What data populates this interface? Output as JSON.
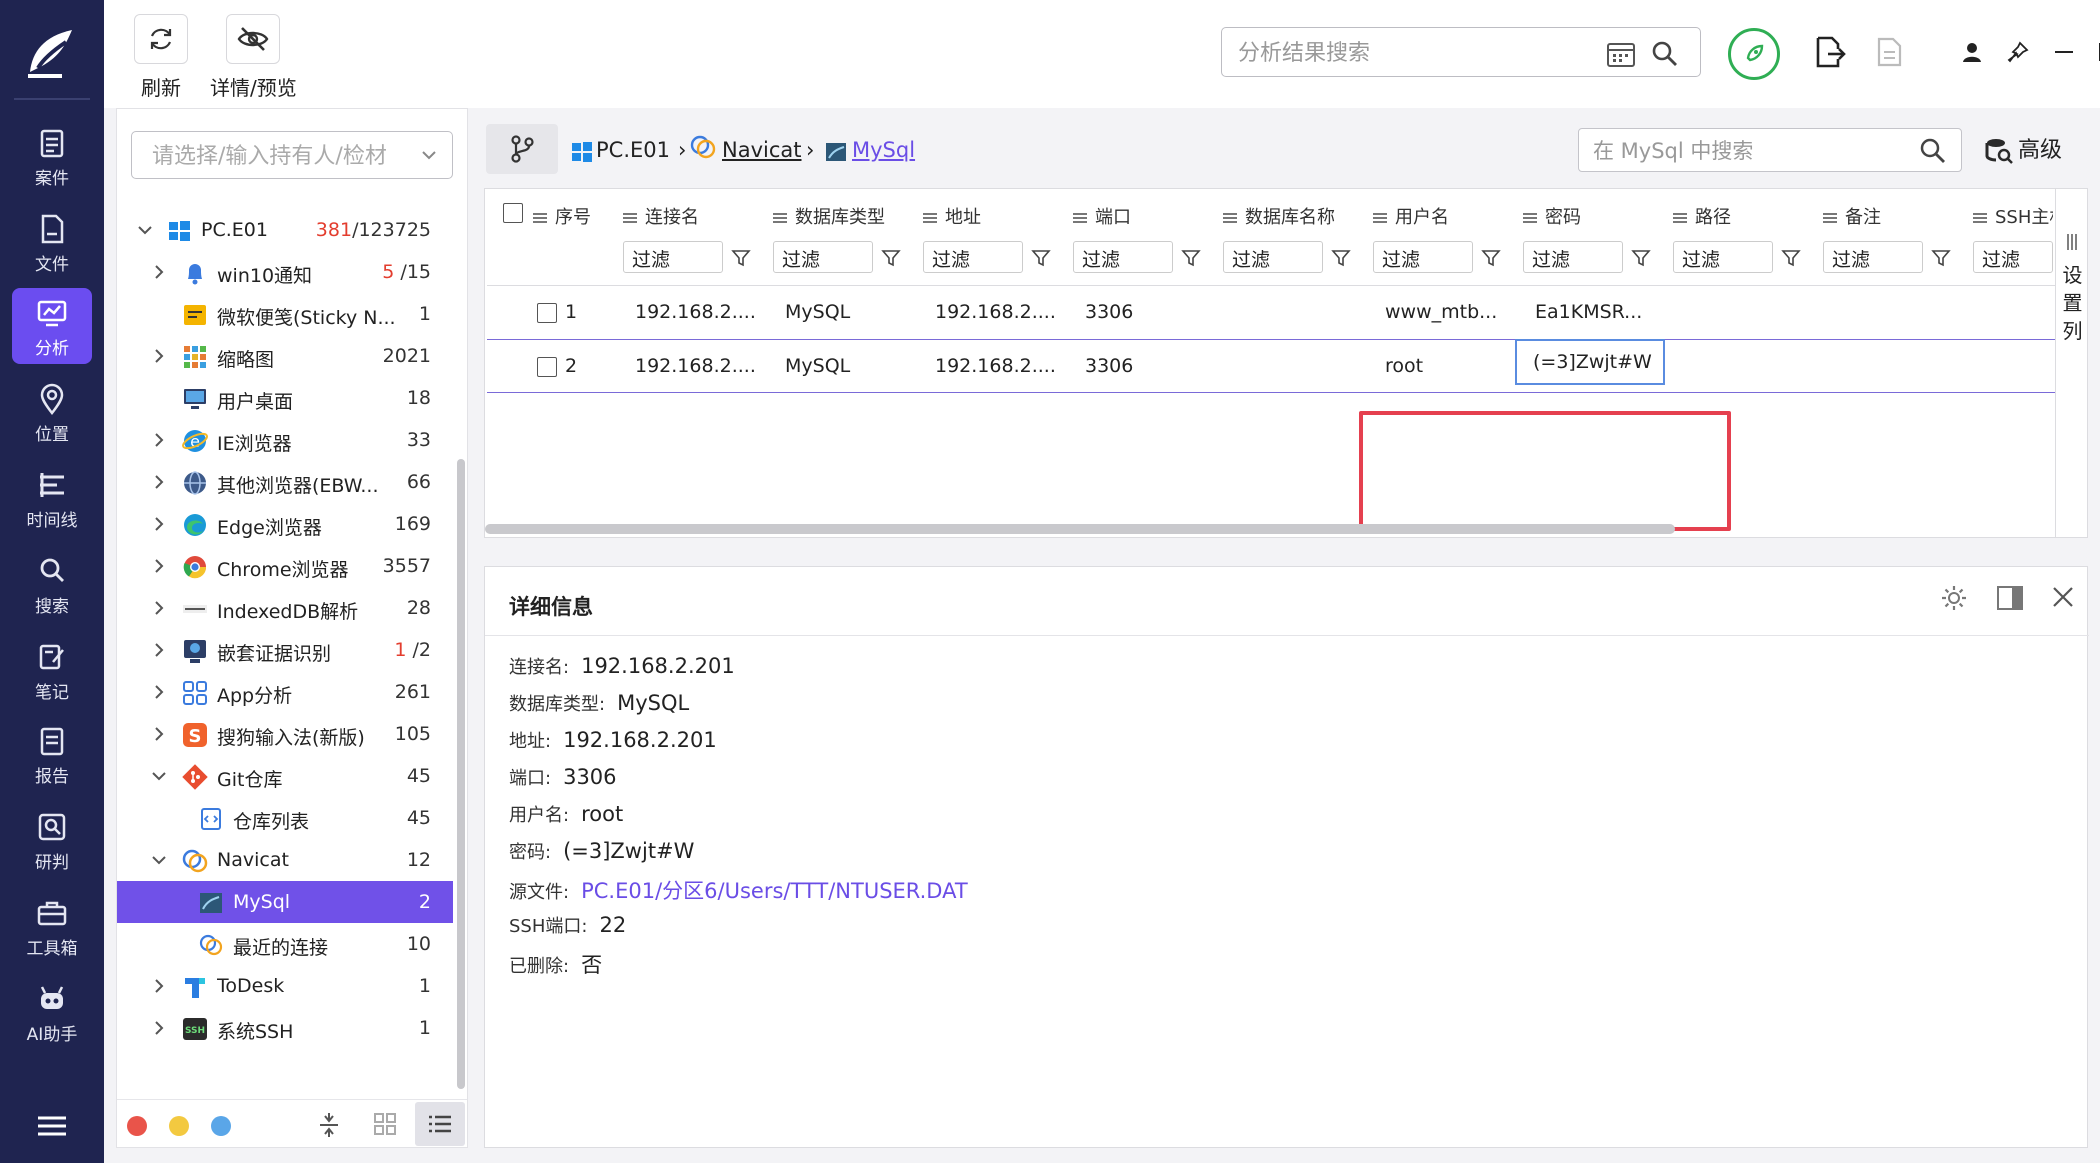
{
  "left_nav": {
    "items": [
      {
        "label": "案件",
        "icon": "clipboard-icon"
      },
      {
        "label": "文件",
        "icon": "file-icon"
      },
      {
        "label": "分析",
        "icon": "analysis-icon"
      },
      {
        "label": "位置",
        "icon": "location-pin-icon"
      },
      {
        "label": "时间线",
        "icon": "timeline-icon"
      },
      {
        "label": "搜索",
        "icon": "search-icon"
      },
      {
        "label": "笔记",
        "icon": "note-icon"
      },
      {
        "label": "报告",
        "icon": "report-icon"
      },
      {
        "label": "研判",
        "icon": "judgement-icon"
      },
      {
        "label": "工具箱",
        "icon": "toolbox-icon"
      },
      {
        "label": "AI助手",
        "icon": "robot-icon"
      }
    ],
    "active": "分析"
  },
  "toolbar": {
    "refresh_label": "刷新",
    "details_label": "详情/预览",
    "search_placeholder": "分析结果搜索"
  },
  "tree": {
    "owner_placeholder": "请选择/输入持有人/检材",
    "items": [
      {
        "label": "PC.E01",
        "count_red": "381",
        "count": "/123725"
      },
      {
        "label": "win10通知",
        "count_red": "5",
        "count": " /15"
      },
      {
        "label": "微软便笺(Sticky N...",
        "count_red": "",
        "count": "1"
      },
      {
        "label": "缩略图",
        "count_red": "",
        "count": "2021"
      },
      {
        "label": "用户桌面",
        "count_red": "",
        "count": "18"
      },
      {
        "label": "IE浏览器",
        "count_red": "",
        "count": "33"
      },
      {
        "label": "其他浏览器(EBW...",
        "count_red": "",
        "count": "66"
      },
      {
        "label": "Edge浏览器",
        "count_red": "",
        "count": "169"
      },
      {
        "label": "Chrome浏览器",
        "count_red": "",
        "count": "3557"
      },
      {
        "label": "IndexedDB解析",
        "count_red": "",
        "count": "28"
      },
      {
        "label": "嵌套证据识别",
        "count_red": "1",
        "count": " /2"
      },
      {
        "label": "App分析",
        "count_red": "",
        "count": "261"
      },
      {
        "label": "搜狗输入法(新版)",
        "count_red": "",
        "count": "105"
      },
      {
        "label": "Git仓库",
        "count_red": "",
        "count": "45"
      },
      {
        "label": "仓库列表",
        "count_red": "",
        "count": "45"
      },
      {
        "label": "Navicat",
        "count_red": "",
        "count": "12"
      },
      {
        "label": "MySql",
        "count_red": "",
        "count": "2"
      },
      {
        "label": "最近的连接",
        "count_red": "",
        "count": "10"
      },
      {
        "label": "ToDesk",
        "count_red": "",
        "count": "1"
      },
      {
        "label": "系统SSH",
        "count_red": "",
        "count": "1"
      }
    ]
  },
  "breadcrumb": {
    "items": [
      "PC.E01",
      "Navicat",
      "MySql"
    ],
    "search_placeholder": "在 MySql 中搜索",
    "advanced_label": "高级"
  },
  "grid": {
    "columns": [
      "序号",
      "连接名",
      "数据库类型",
      "地址",
      "端口",
      "数据库名称",
      "用户名",
      "密码",
      "路径",
      "备注",
      "SSH主机"
    ],
    "filter_label": "过滤",
    "settings_label": "设置列",
    "rows": [
      {
        "index": "1",
        "conn": "192.168.2....",
        "dbtype": "MySQL",
        "addr": "192.168.2....",
        "port": "3306",
        "dbname": "",
        "user": "www_mtb...",
        "password": "Ea1KMSR..."
      },
      {
        "index": "2",
        "conn": "192.168.2....",
        "dbtype": "MySQL",
        "addr": "192.168.2....",
        "port": "3306",
        "dbname": "",
        "user": "root",
        "password": "(=3]Zwjt#W"
      }
    ]
  },
  "detail": {
    "title": "详细信息",
    "fields": [
      {
        "label": "连接名:",
        "value": "192.168.2.201"
      },
      {
        "label": "数据库类型:",
        "value": "MySQL"
      },
      {
        "label": "地址:",
        "value": "192.168.2.201"
      },
      {
        "label": "端口:",
        "value": "3306"
      },
      {
        "label": "用户名:",
        "value": "root"
      },
      {
        "label": "密码:",
        "value": "(=3]Zwjt#W"
      },
      {
        "label": "源文件:",
        "value": "PC.E01/分区6/Users/TTT/NTUSER.DAT"
      },
      {
        "label": "SSH端口:",
        "value": "22"
      },
      {
        "label": "已删除:",
        "value": "否"
      }
    ]
  },
  "colors": {
    "nav_bg": "#1f2450",
    "accent": "#6b4df0",
    "highlight_box": "#e5404f",
    "link": "#6a4de6"
  }
}
